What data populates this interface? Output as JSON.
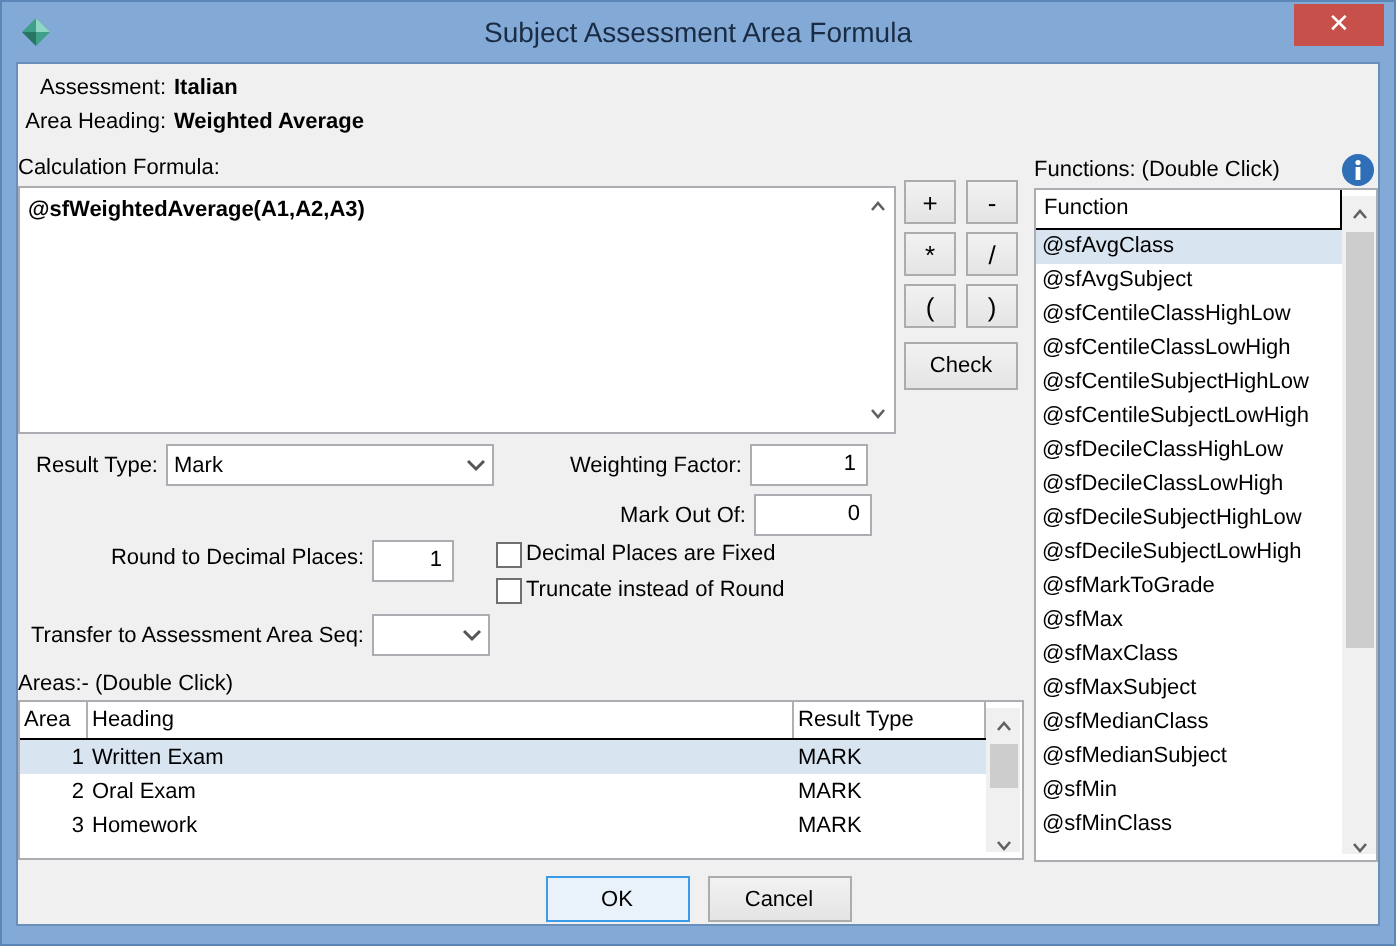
{
  "window": {
    "title": "Subject Assessment Area Formula",
    "close": "✕"
  },
  "assessment": {
    "label": "Assessment:",
    "value": "Italian"
  },
  "area_heading": {
    "label": "Area Heading:",
    "value": "Weighted Average"
  },
  "formula": {
    "label": "Calculation Formula:",
    "value": "@sfWeightedAverage(A1,A2,A3)"
  },
  "operators": [
    "+",
    "-",
    "*",
    "/",
    "(",
    ")"
  ],
  "check_button": "Check",
  "result_type": {
    "label": "Result Type:",
    "value": "Mark"
  },
  "weighting_factor": {
    "label": "Weighting Factor:",
    "value": "1"
  },
  "mark_out_of": {
    "label": "Mark Out Of:",
    "value": "0"
  },
  "round_to_decimal_places": {
    "label": "Round to Decimal Places:",
    "value": "1"
  },
  "checkboxes": [
    {
      "label": "Decimal Places are Fixed",
      "checked": false
    },
    {
      "label": "Truncate instead of Round",
      "checked": false
    }
  ],
  "transfer": {
    "label": "Transfer to Assessment Area Seq:"
  },
  "areas": {
    "label": "Areas:-  (Double Click)",
    "columns": [
      "Area",
      "Heading",
      "Result Type"
    ],
    "rows": [
      {
        "area": "1",
        "heading": "Written Exam",
        "result_type": "MARK",
        "selected": true
      },
      {
        "area": "2",
        "heading": "Oral Exam",
        "result_type": "MARK",
        "selected": false
      },
      {
        "area": "3",
        "heading": "Homework",
        "result_type": "MARK",
        "selected": false
      }
    ]
  },
  "functions": {
    "label": "Functions:  (Double Click)",
    "column": "Function",
    "items": [
      {
        "name": "@sfAvgClass",
        "selected": true
      },
      {
        "name": "@sfAvgSubject",
        "selected": false
      },
      {
        "name": "@sfCentileClassHighLow",
        "selected": false
      },
      {
        "name": "@sfCentileClassLowHigh",
        "selected": false
      },
      {
        "name": "@sfCentileSubjectHighLow",
        "selected": false
      },
      {
        "name": "@sfCentileSubjectLowHigh",
        "selected": false
      },
      {
        "name": "@sfDecileClassHighLow",
        "selected": false
      },
      {
        "name": "@sfDecileClassLowHigh",
        "selected": false
      },
      {
        "name": "@sfDecileSubjectHighLow",
        "selected": false
      },
      {
        "name": "@sfDecileSubjectLowHigh",
        "selected": false
      },
      {
        "name": "@sfMarkToGrade",
        "selected": false
      },
      {
        "name": "@sfMax",
        "selected": false
      },
      {
        "name": "@sfMaxClass",
        "selected": false
      },
      {
        "name": "@sfMaxSubject",
        "selected": false
      },
      {
        "name": "@sfMedianClass",
        "selected": false
      },
      {
        "name": "@sfMedianSubject",
        "selected": false
      },
      {
        "name": "@sfMin",
        "selected": false
      },
      {
        "name": "@sfMinClass",
        "selected": false
      }
    ]
  },
  "buttons": [
    {
      "label": "OK",
      "default": true
    },
    {
      "label": "Cancel",
      "default": false
    }
  ]
}
